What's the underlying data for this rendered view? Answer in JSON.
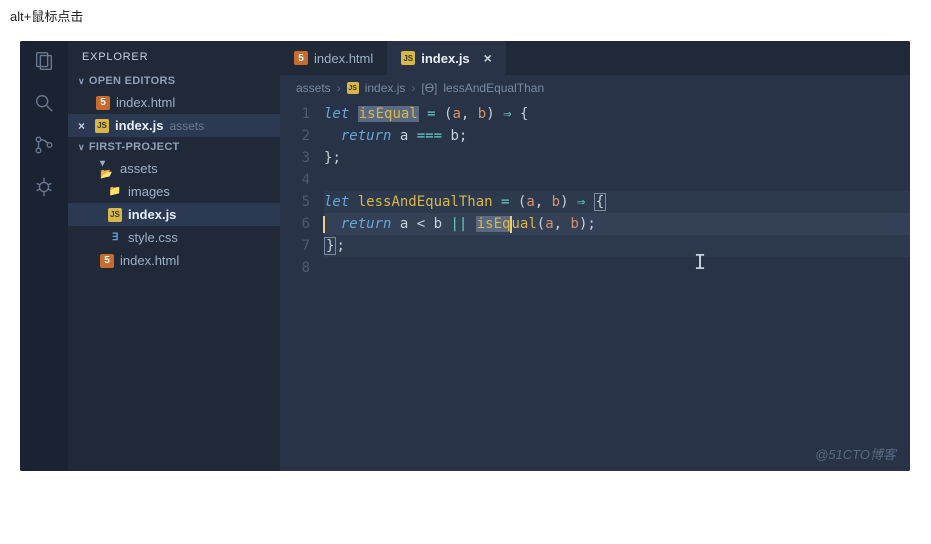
{
  "page_header": "alt+鼠标点击",
  "watermark": "@51CTO博客",
  "sidebar": {
    "title": "EXPLORER",
    "sections": {
      "open_editors": {
        "label": "OPEN EDITORS",
        "items": [
          {
            "name": "index.html",
            "icon": "html"
          },
          {
            "name": "index.js",
            "icon": "js",
            "suffix": "assets",
            "active": true,
            "closeable": true
          }
        ]
      },
      "project": {
        "label": "FIRST-PROJECT",
        "items": [
          {
            "name": "assets",
            "icon": "folder-open",
            "level": 0
          },
          {
            "name": "images",
            "icon": "folder",
            "level": 1
          },
          {
            "name": "index.js",
            "icon": "js",
            "level": 1,
            "active": true
          },
          {
            "name": "style.css",
            "icon": "css",
            "level": 1
          },
          {
            "name": "index.html",
            "icon": "html",
            "level": 0
          }
        ]
      }
    }
  },
  "tabs": [
    {
      "name": "index.html",
      "icon": "html"
    },
    {
      "name": "index.js",
      "icon": "js",
      "active": true,
      "closeable": true
    }
  ],
  "breadcrumbs": {
    "folder": "assets",
    "file": "index.js",
    "symbol_icon": "[ϴ]",
    "symbol": "lessAndEqualThan"
  },
  "code": {
    "line_numbers": [
      "1",
      "2",
      "3",
      "4",
      "5",
      "6",
      "7",
      "8"
    ],
    "tokens": {
      "l1_let": "let",
      "l1_name": "isEqual",
      "l1_eq": " = ",
      "l1_paren_o": "(",
      "l1_a": "a",
      "l1_comma": ", ",
      "l1_b": "b",
      "l1_paren_c": ")",
      "l1_arrow": " ⇒ ",
      "l1_brace": "{",
      "l2_return": "return",
      "l2_a": " a ",
      "l2_eqeq": "===",
      "l2_b": " b",
      "l2_semi": ";",
      "l3_brace": "}",
      "l3_semi": ";",
      "l5_let": "let",
      "l5_name": " lessAndEqualThan",
      "l5_eq": " = ",
      "l5_paren_o": "(",
      "l5_a": "a",
      "l5_comma": ", ",
      "l5_b": "b",
      "l5_paren_c": ")",
      "l5_arrow": " ⇒ ",
      "l5_brace": "{",
      "l6_return": "return",
      "l6_expr1": " a < b ",
      "l6_or": "||",
      "l6_sp": " ",
      "l6_call_pre": "isEq",
      "l6_call_post": "ual",
      "l6_paren_o": "(",
      "l6_a": "a",
      "l6_comma": ", ",
      "l6_b": "b",
      "l6_paren_c": ")",
      "l6_semi": ";",
      "l7_brace": "}",
      "l7_semi": ";"
    }
  }
}
